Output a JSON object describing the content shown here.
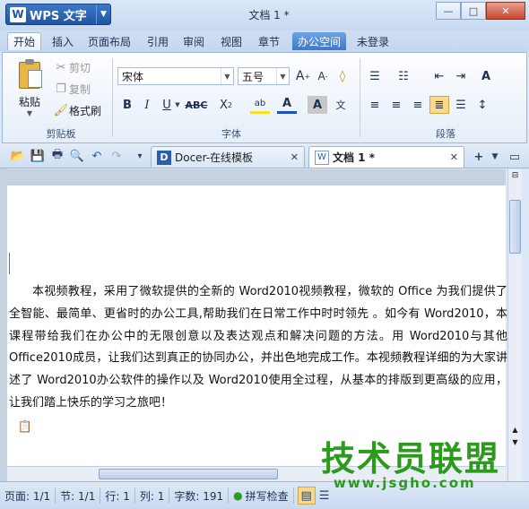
{
  "app": {
    "name": "WPS 文字",
    "logo": "W",
    "doc_title": "文档 1 *"
  },
  "menus": [
    "开始",
    "插入",
    "页面布局",
    "引用",
    "审阅",
    "视图",
    "章节",
    "办公空间"
  ],
  "login": "未登录",
  "clipboard": {
    "paste": "粘贴",
    "cut": "剪切",
    "copy": "复制",
    "format_painter": "格式刷",
    "group": "剪贴板"
  },
  "font": {
    "name": "宋体",
    "size": "五号",
    "group": "字体"
  },
  "paragraph": {
    "group": "段落"
  },
  "tabs": [
    {
      "label": "Docer-在线模板"
    },
    {
      "label": "文档 1 *"
    }
  ],
  "document": {
    "text": "本视频教程，采用了微软提供的全新的 Word2010视频教程，微软的 Office 为我们提供了全智能、最简单、更省时的办公工具,帮助我们在日常工作中时时领先 。如今有 Word2010，本课程带给我们在办公中的无限创意以及表达观点和解决问题的方法。用 Word2010与其他 Office2010成员，让我们达到真正的协同办公，并出色地完成工作。本视频教程详细的为大家讲述了 Word2010办公软件的操作以及 Word2010使用全过程，从基本的排版到更高级的应用，让我们踏上快乐的学习之旅吧！"
  },
  "status": {
    "page": "页面: 1/1",
    "section": "节: 1/1",
    "row": "行: 1",
    "col": "列: 1",
    "words": "字数: 191",
    "spell": "拼写检查"
  },
  "watermark": {
    "title": "技术员联盟",
    "url": "www.jsgho.com"
  }
}
